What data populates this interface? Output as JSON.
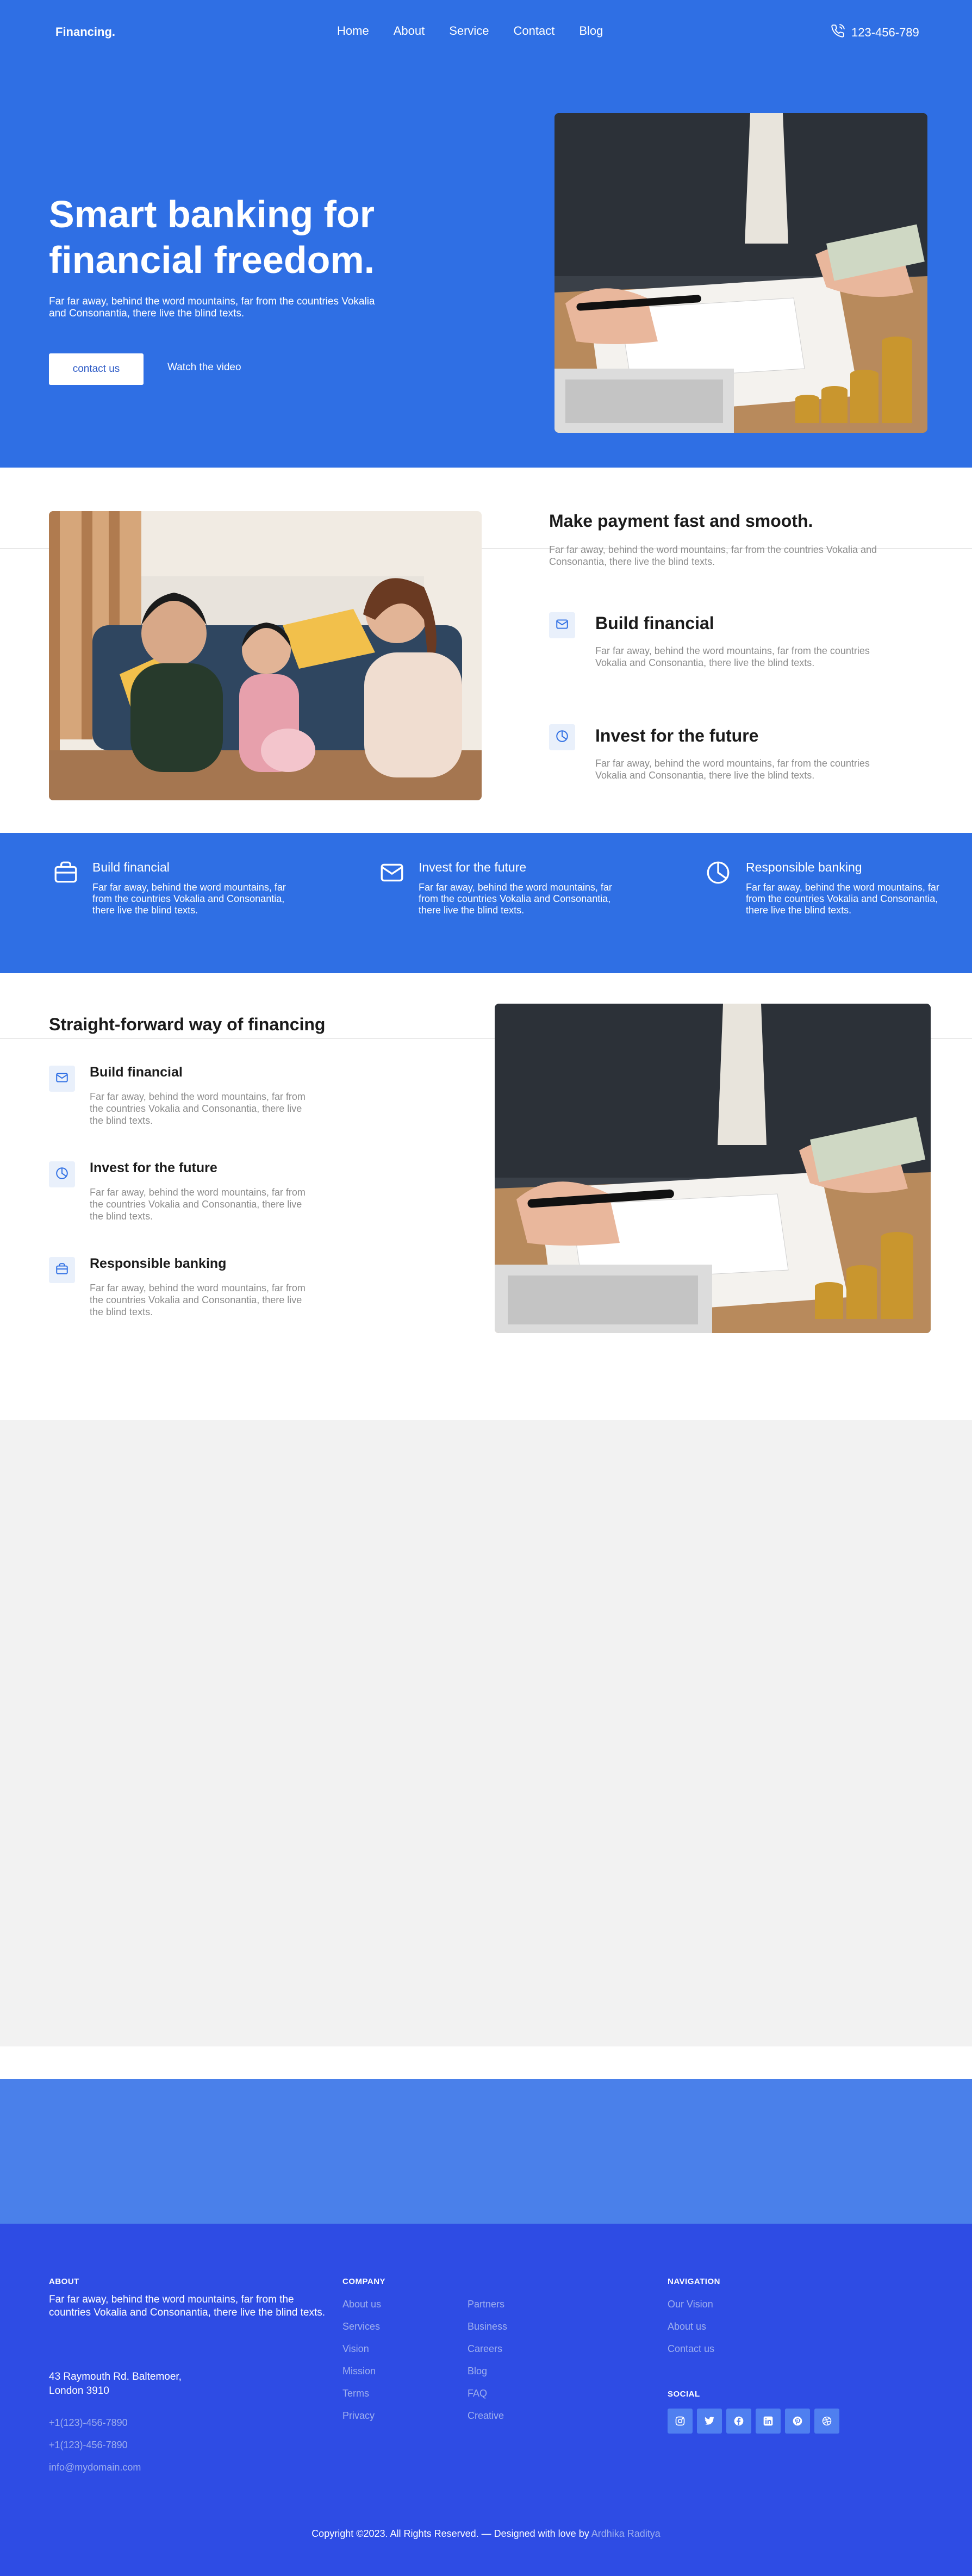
{
  "header": {
    "brand": "Financing.",
    "nav": [
      "Home",
      "About",
      "Service",
      "Contact",
      "Blog"
    ],
    "phone": "123-456-789"
  },
  "hero": {
    "title": "Smart banking for financial freedom.",
    "subtitle": "Far far away, behind the word mountains, far from the countries Vokalia and Consonantia, there live the blind texts.",
    "contact_button": "contact us",
    "video_link": "Watch the video"
  },
  "section1": {
    "title": "Make payment fast and smooth.",
    "text": "Far far away, behind the word mountains, far from the countries Vokalia and Consonantia, there live the blind texts.",
    "features": [
      {
        "title": "Build financial",
        "text": "Far far away, behind the word mountains, far from the countries Vokalia and Consonantia, there live the blind texts.",
        "icon": "envelope-icon"
      },
      {
        "title": "Invest for the future",
        "text": "Far far away, behind the word mountains, far from the countries Vokalia and Consonantia, there live the blind texts.",
        "icon": "pie-chart-icon"
      }
    ]
  },
  "band": {
    "items": [
      {
        "title": "Build financial",
        "text": "Far far away, behind the word mountains, far from the countries Vokalia and Consonantia, there live the blind texts.",
        "icon": "briefcase-icon"
      },
      {
        "title": "Invest for the future",
        "text": "Far far away, behind the word mountains, far from the countries Vokalia and Consonantia, there live the blind texts.",
        "icon": "envelope-icon"
      },
      {
        "title": "Responsible banking",
        "text": "Far far away, behind the word mountains, far from the countries Vokalia and Consonantia, there live the blind texts.",
        "icon": "pie-chart-icon"
      }
    ]
  },
  "section3": {
    "title": "Straight-forward way of financing",
    "features": [
      {
        "title": "Build financial",
        "text": "Far far away, behind the word mountains, far from the countries Vokalia and Consonantia, there live the blind texts.",
        "icon": "envelope-icon"
      },
      {
        "title": "Invest for the future",
        "text": "Far far away, behind the word mountains, far from the countries Vokalia and Consonantia, there live the blind texts.",
        "icon": "pie-chart-icon"
      },
      {
        "title": "Responsible banking",
        "text": "Far far away, behind the word mountains, far from the countries Vokalia and Consonantia, there live the blind texts.",
        "icon": "briefcase-icon"
      }
    ]
  },
  "footer": {
    "about_heading": "ABOUT",
    "about_text": "Far far away, behind the word mountains, far from the countries Vokalia and Consonantia, there live the blind texts.",
    "address_line1": "43 Raymouth Rd. Baltemoer,",
    "address_line2": "London 3910",
    "phone1": "+1(123)-456-7890",
    "phone2": "+1(123)-456-7890",
    "email": "info@mydomain.com",
    "company_heading": "COMPANY",
    "company_col1": [
      "About us",
      "Services",
      "Vision",
      "Mission",
      "Terms",
      "Privacy"
    ],
    "company_col2": [
      "Partners",
      "Business",
      "Careers",
      "Blog",
      "FAQ",
      "Creative"
    ],
    "navigation_heading": "NAVIGATION",
    "navigation_links": [
      "Our Vision",
      "About us",
      "Contact us"
    ],
    "social_heading": "SOCIAL",
    "social_icons": [
      "instagram-icon",
      "twitter-icon",
      "facebook-icon",
      "linkedin-icon",
      "pinterest-icon",
      "dribbble-icon"
    ],
    "copyright": "Copyright ©2023. All Rights Reserved. — Designed with love by",
    "credit": "Ardhika Raditya"
  },
  "colors": {
    "primary_blue": "#2f6fe4",
    "footer_blue": "#2e4ce4",
    "light_band": "#4a80ea",
    "grey_area": "#f2f2f2"
  }
}
